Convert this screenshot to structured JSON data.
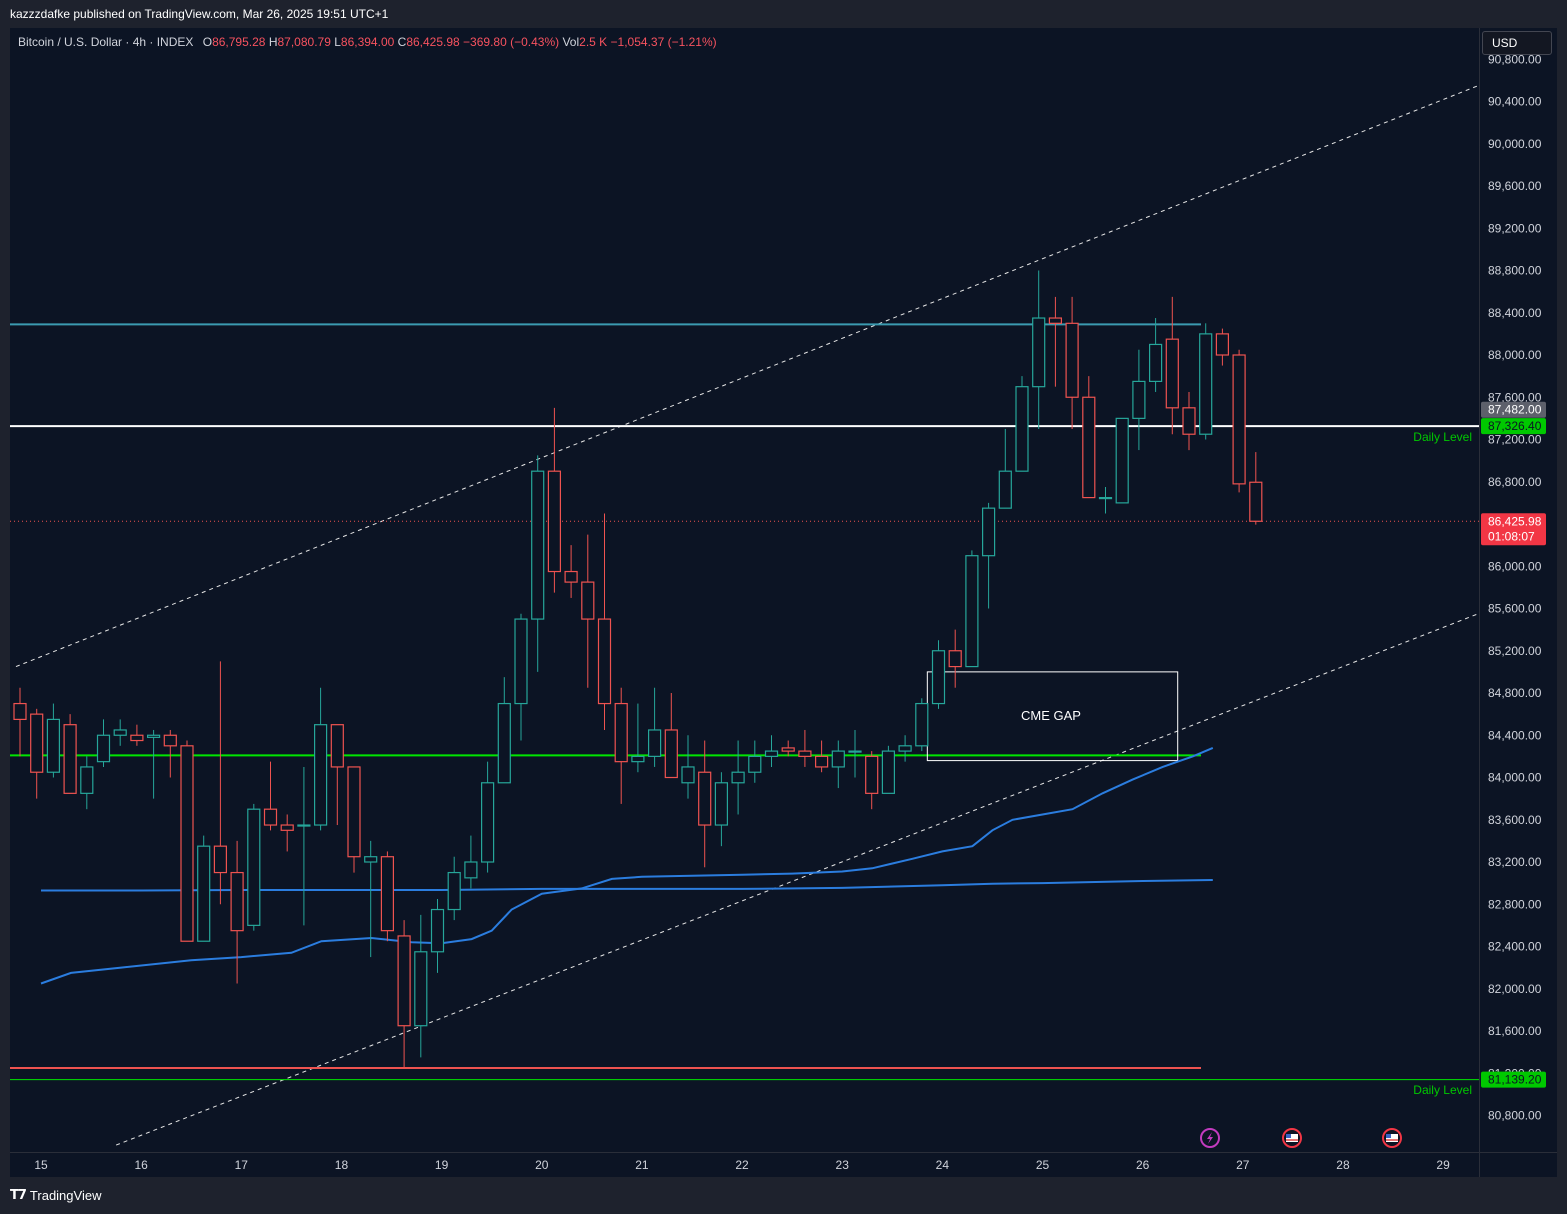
{
  "header": {
    "published_text": "kazzzdafke published on TradingView.com, Mar 26, 2025 19:51 UTC+1"
  },
  "legend": {
    "symbol": "Bitcoin / U.S. Dollar · 4h · INDEX",
    "open_label": "O",
    "open": "86,795.28",
    "high_label": "H",
    "high": "87,080.79",
    "low_label": "L",
    "low": "86,394.00",
    "close_label": "C",
    "close": "86,425.98",
    "change": "−369.80 (−0.43%)",
    "vol_label": "Vol",
    "vol": "2.5 K",
    "vol_change": "−1,054.37 (−1.21%)"
  },
  "currency": "USD",
  "price_axis": {
    "ticks": [
      "90,800.00",
      "90,400.00",
      "90,000.00",
      "89,600.00",
      "89,200.00",
      "88,800.00",
      "88,400.00",
      "88,000.00",
      "87,600.00",
      "87,200.00",
      "86,800.00",
      "86,000.00",
      "85,600.00",
      "85,200.00",
      "84,800.00",
      "84,400.00",
      "84,000.00",
      "83,600.00",
      "83,200.00",
      "82,800.00",
      "82,400.00",
      "82,000.00",
      "81,600.00",
      "81,200.00",
      "80,800.00"
    ],
    "labels": {
      "high_marker": "87,482.00",
      "daily_level_upper": "87,326.40",
      "last_price": "86,425.98",
      "countdown": "01:08:07",
      "daily_level_lower": "81,139.20"
    }
  },
  "time_axis": [
    "15",
    "16",
    "17",
    "18",
    "19",
    "20",
    "21",
    "22",
    "23",
    "24",
    "25",
    "26",
    "27",
    "28",
    "29"
  ],
  "annotations": {
    "cme_gap": "CME GAP",
    "daily_level_upper": "Daily Level",
    "daily_level_lower": "Daily Level"
  },
  "colors": {
    "background": "#0c1424",
    "up": "#26a69a",
    "down": "#ef5350",
    "ma": "#2b7ddf",
    "green_level": "#00e600",
    "teal_level": "#3b9bb0",
    "red_level": "#ef5350",
    "white_level": "#ffffff"
  },
  "chart_data": {
    "type": "candlestick",
    "timeframe": "4h",
    "ylim": [
      80600,
      90950
    ],
    "x_dates": [
      "15",
      "16",
      "17",
      "18",
      "19",
      "20",
      "21",
      "22",
      "23",
      "24",
      "25",
      "26",
      "27",
      "28",
      "29"
    ],
    "horizontal_lines": [
      {
        "name": "resistance",
        "price": 88290,
        "color": "#3b9bb0"
      },
      {
        "name": "daily-level-upper",
        "price": 87326.4,
        "color": "#ffffff"
      },
      {
        "name": "support-green",
        "price": 84210,
        "color": "#00e600"
      },
      {
        "name": "daily-level-lower",
        "price": 81139.2,
        "color": "#00e600"
      },
      {
        "name": "red-level",
        "price": 81250,
        "color": "#ef5350"
      },
      {
        "name": "last-price",
        "price": 86425.98,
        "color": "#ef5350"
      }
    ],
    "candles": [
      {
        "o": 84700,
        "h": 84850,
        "l": 84200,
        "c": 84550
      },
      {
        "o": 84600,
        "h": 84650,
        "l": 83800,
        "c": 84050
      },
      {
        "o": 84050,
        "h": 84700,
        "l": 84000,
        "c": 84550
      },
      {
        "o": 84500,
        "h": 84600,
        "l": 83850,
        "c": 83850
      },
      {
        "o": 83850,
        "h": 84200,
        "l": 83700,
        "c": 84100
      },
      {
        "o": 84150,
        "h": 84550,
        "l": 84100,
        "c": 84400
      },
      {
        "o": 84400,
        "h": 84550,
        "l": 84300,
        "c": 84450
      },
      {
        "o": 84400,
        "h": 84500,
        "l": 84300,
        "c": 84350
      },
      {
        "o": 84380,
        "h": 84450,
        "l": 83800,
        "c": 84400
      },
      {
        "o": 84400,
        "h": 84450,
        "l": 84000,
        "c": 84300
      },
      {
        "o": 84300,
        "h": 84350,
        "l": 82450,
        "c": 82450
      },
      {
        "o": 82450,
        "h": 83450,
        "l": 82450,
        "c": 83350
      },
      {
        "o": 83350,
        "h": 85100,
        "l": 82800,
        "c": 83100
      },
      {
        "o": 83100,
        "h": 83400,
        "l": 82050,
        "c": 82550
      },
      {
        "o": 82600,
        "h": 83750,
        "l": 82550,
        "c": 83700
      },
      {
        "o": 83700,
        "h": 84150,
        "l": 83500,
        "c": 83550
      },
      {
        "o": 83550,
        "h": 83650,
        "l": 83300,
        "c": 83500
      },
      {
        "o": 83550,
        "h": 84100,
        "l": 82600,
        "c": 83550
      },
      {
        "o": 83550,
        "h": 84850,
        "l": 83500,
        "c": 84500
      },
      {
        "o": 84500,
        "h": 84500,
        "l": 83550,
        "c": 84100
      },
      {
        "o": 84100,
        "h": 84100,
        "l": 83100,
        "c": 83250
      },
      {
        "o": 83200,
        "h": 83400,
        "l": 82300,
        "c": 83250
      },
      {
        "o": 83250,
        "h": 83300,
        "l": 82450,
        "c": 82550
      },
      {
        "o": 82500,
        "h": 82650,
        "l": 81250,
        "c": 81650
      },
      {
        "o": 81650,
        "h": 82700,
        "l": 81350,
        "c": 82350
      },
      {
        "o": 82350,
        "h": 82850,
        "l": 82150,
        "c": 82750
      },
      {
        "o": 82750,
        "h": 83250,
        "l": 82650,
        "c": 83100
      },
      {
        "o": 83050,
        "h": 83450,
        "l": 82950,
        "c": 83200
      },
      {
        "o": 83200,
        "h": 84150,
        "l": 83100,
        "c": 83950
      },
      {
        "o": 83950,
        "h": 84950,
        "l": 83950,
        "c": 84700
      },
      {
        "o": 84700,
        "h": 85550,
        "l": 84350,
        "c": 85500
      },
      {
        "o": 85500,
        "h": 87050,
        "l": 85000,
        "c": 86900
      },
      {
        "o": 86900,
        "h": 87500,
        "l": 85750,
        "c": 85950
      },
      {
        "o": 85950,
        "h": 86200,
        "l": 85700,
        "c": 85850
      },
      {
        "o": 85850,
        "h": 86300,
        "l": 84850,
        "c": 85500
      },
      {
        "o": 85500,
        "h": 86500,
        "l": 84450,
        "c": 84700
      },
      {
        "o": 84700,
        "h": 84850,
        "l": 83750,
        "c": 84150
      },
      {
        "o": 84150,
        "h": 84700,
        "l": 84050,
        "c": 84200
      },
      {
        "o": 84200,
        "h": 84850,
        "l": 84100,
        "c": 84450
      },
      {
        "o": 84450,
        "h": 84800,
        "l": 84000,
        "c": 84000
      },
      {
        "o": 83950,
        "h": 84400,
        "l": 83800,
        "c": 84100
      },
      {
        "o": 84050,
        "h": 84350,
        "l": 83150,
        "c": 83550
      },
      {
        "o": 83550,
        "h": 84050,
        "l": 83350,
        "c": 83950
      },
      {
        "o": 83950,
        "h": 84350,
        "l": 83650,
        "c": 84050
      },
      {
        "o": 84050,
        "h": 84350,
        "l": 83950,
        "c": 84200
      },
      {
        "o": 84200,
        "h": 84400,
        "l": 84100,
        "c": 84250
      },
      {
        "o": 84280,
        "h": 84350,
        "l": 84200,
        "c": 84250
      },
      {
        "o": 84250,
        "h": 84450,
        "l": 84100,
        "c": 84200
      },
      {
        "o": 84200,
        "h": 84350,
        "l": 84050,
        "c": 84100
      },
      {
        "o": 84100,
        "h": 84350,
        "l": 83900,
        "c": 84250
      },
      {
        "o": 84250,
        "h": 84450,
        "l": 84000,
        "c": 84250
      },
      {
        "o": 84200,
        "h": 84250,
        "l": 83700,
        "c": 83850
      },
      {
        "o": 83850,
        "h": 84300,
        "l": 83850,
        "c": 84250
      },
      {
        "o": 84250,
        "h": 84400,
        "l": 84150,
        "c": 84300
      },
      {
        "o": 84300,
        "h": 84750,
        "l": 84250,
        "c": 84700
      },
      {
        "o": 84700,
        "h": 85300,
        "l": 84650,
        "c": 85200
      },
      {
        "o": 85200,
        "h": 85400,
        "l": 84850,
        "c": 85050
      },
      {
        "o": 85050,
        "h": 86150,
        "l": 85050,
        "c": 86100
      },
      {
        "o": 86100,
        "h": 86600,
        "l": 85600,
        "c": 86550
      },
      {
        "o": 86550,
        "h": 87300,
        "l": 86550,
        "c": 86900
      },
      {
        "o": 86900,
        "h": 87800,
        "l": 86900,
        "c": 87700
      },
      {
        "o": 87700,
        "h": 88800,
        "l": 87300,
        "c": 88350
      },
      {
        "o": 88350,
        "h": 88550,
        "l": 87700,
        "c": 88300
      },
      {
        "o": 88300,
        "h": 88550,
        "l": 87300,
        "c": 87600
      },
      {
        "o": 87600,
        "h": 87800,
        "l": 86650,
        "c": 86650
      },
      {
        "o": 86650,
        "h": 86750,
        "l": 86500,
        "c": 86650
      },
      {
        "o": 86600,
        "h": 87400,
        "l": 86600,
        "c": 87400
      },
      {
        "o": 87400,
        "h": 88050,
        "l": 87100,
        "c": 87750
      },
      {
        "o": 87750,
        "h": 88350,
        "l": 87650,
        "c": 88100
      },
      {
        "o": 88150,
        "h": 88550,
        "l": 87250,
        "c": 87500
      },
      {
        "o": 87500,
        "h": 87650,
        "l": 87100,
        "c": 87250
      },
      {
        "o": 87250,
        "h": 88300,
        "l": 87200,
        "c": 88200
      },
      {
        "o": 88200,
        "h": 88250,
        "l": 87900,
        "c": 88000
      },
      {
        "o": 88000,
        "h": 88050,
        "l": 86700,
        "c": 86780
      },
      {
        "o": 86795.28,
        "h": 87080.79,
        "l": 86394,
        "c": 86425.98
      }
    ],
    "moving_averages": [
      {
        "name": "ma-fast",
        "color": "#2b7ddf",
        "points": [
          [
            15,
            82050
          ],
          [
            15.3,
            82150
          ],
          [
            15.8,
            82200
          ],
          [
            16.5,
            82270
          ],
          [
            17,
            82300
          ],
          [
            17.5,
            82340
          ],
          [
            17.8,
            82450
          ],
          [
            18.3,
            82480
          ],
          [
            18.7,
            82440
          ],
          [
            19,
            82430
          ],
          [
            19.3,
            82470
          ],
          [
            19.5,
            82550
          ],
          [
            19.7,
            82750
          ],
          [
            20,
            82900
          ],
          [
            20.4,
            82950
          ],
          [
            20.7,
            83040
          ],
          [
            21,
            83060
          ],
          [
            21.5,
            83070
          ],
          [
            22,
            83080
          ],
          [
            22.5,
            83090
          ],
          [
            23,
            83110
          ],
          [
            23.3,
            83140
          ],
          [
            23.7,
            83230
          ],
          [
            24,
            83300
          ],
          [
            24.3,
            83350
          ],
          [
            24.5,
            83500
          ],
          [
            24.7,
            83600
          ],
          [
            25,
            83650
          ],
          [
            25.3,
            83700
          ],
          [
            25.6,
            83850
          ],
          [
            25.9,
            83980
          ],
          [
            26.2,
            84100
          ],
          [
            26.5,
            84200
          ],
          [
            26.7,
            84280
          ]
        ]
      },
      {
        "name": "ma-slow",
        "color": "#2b7ddf",
        "points": [
          [
            15,
            82930
          ],
          [
            16,
            82930
          ],
          [
            17,
            82935
          ],
          [
            18,
            82935
          ],
          [
            19,
            82935
          ],
          [
            20,
            82945
          ],
          [
            21,
            82945
          ],
          [
            22,
            82945
          ],
          [
            23,
            82955
          ],
          [
            24,
            82980
          ],
          [
            24.5,
            82995
          ],
          [
            25,
            83000
          ],
          [
            26,
            83020
          ],
          [
            26.7,
            83030
          ]
        ]
      }
    ],
    "channel_lines": [
      {
        "name": "channel-upper",
        "from": [
          14.75,
          85050
        ],
        "to": [
          29.35,
          90550
        ]
      },
      {
        "name": "channel-lower",
        "from": [
          15.75,
          80520
        ],
        "to": [
          29.35,
          85550
        ]
      }
    ],
    "zones": [
      {
        "name": "cme-gap",
        "x1": 23.85,
        "x2": 26.35,
        "price_top": 85000,
        "price_bottom": 84160,
        "label": "CME GAP"
      }
    ]
  }
}
